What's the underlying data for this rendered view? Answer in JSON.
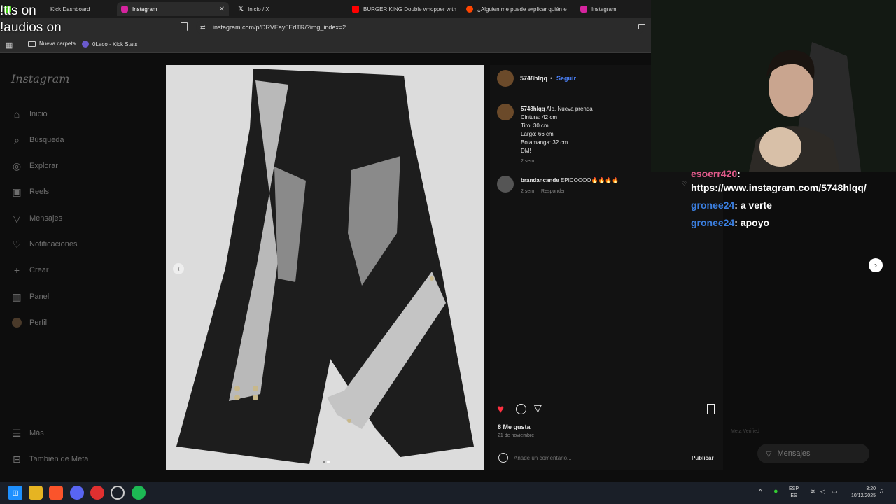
{
  "overlay_text": {
    "line1": "!tts on",
    "line2": "!audios on"
  },
  "tabs": [
    {
      "label": "Kick Dashboard",
      "color": "#53fc18"
    },
    {
      "label": "Instagram",
      "color": "#d6249f",
      "active": true
    },
    {
      "label": "Inicio / X",
      "color": "#ffffff"
    },
    {
      "label": "BURGER KING Double whopper with",
      "color": "#ff0000"
    },
    {
      "label": "¿Alguien me puede explicar quién e",
      "color": "#ff4500"
    },
    {
      "label": "Instagram",
      "color": "#d6249f"
    }
  ],
  "address": {
    "url": "instagram.com/p/DRVEay6EdTR/?img_index=2"
  },
  "bookmarks": [
    {
      "label": "Nueva carpeta"
    },
    {
      "label": "0Laco - Kick Stats"
    }
  ],
  "sidebar": {
    "logo": "Instagram",
    "items": [
      {
        "label": "Inicio",
        "icon": "home-icon"
      },
      {
        "label": "Búsqueda",
        "icon": "search-icon"
      },
      {
        "label": "Explorar",
        "icon": "compass-icon"
      },
      {
        "label": "Reels",
        "icon": "reels-icon"
      },
      {
        "label": "Mensajes",
        "icon": "send-icon"
      },
      {
        "label": "Notificaciones",
        "icon": "heart-icon"
      },
      {
        "label": "Crear",
        "icon": "plus-icon"
      },
      {
        "label": "Panel",
        "icon": "chart-icon"
      },
      {
        "label": "Perfil",
        "icon": "avatar-icon"
      }
    ],
    "more": "Más",
    "meta": "También de Meta"
  },
  "post": {
    "username": "5748hlqq",
    "follow": "Seguir",
    "caption_user": "5748hlqq",
    "caption_lines": [
      "Alo, Nueva prenda",
      "Cintura: 42 cm",
      "Tiro: 30 cm",
      "Largo: 66 cm",
      "Botamanga: 32 cm",
      "DM!"
    ],
    "caption_time": "2 sem",
    "comment_user": "brandancande",
    "comment_text": "EPICOOOO🔥🔥🔥🔥",
    "comment_time": "2 sem",
    "comment_reply": "Responder",
    "likes": "8 Me gusta",
    "date": "21 de noviembre",
    "add_comment_placeholder": "Añade un comentario...",
    "publish": "Publicar"
  },
  "chat": {
    "messages": [
      {
        "user": "esoerr420",
        "text": "https://www.instagram.com/5748hlqq/"
      },
      {
        "user": "gronee24",
        "text": "a verte"
      },
      {
        "user": "gronee24",
        "text": "apoyo"
      }
    ]
  },
  "messages_button": "Mensajes",
  "meta_verified": "Meta Verified",
  "taskbar": {
    "lang": "ESP",
    "lang2": "ES",
    "time": "3:20",
    "date": "10/12/2025"
  },
  "colors": {
    "like_red": "#ff3040",
    "link_blue": "#4a7ff5",
    "chat_name_blue": "#3b7fe0"
  }
}
